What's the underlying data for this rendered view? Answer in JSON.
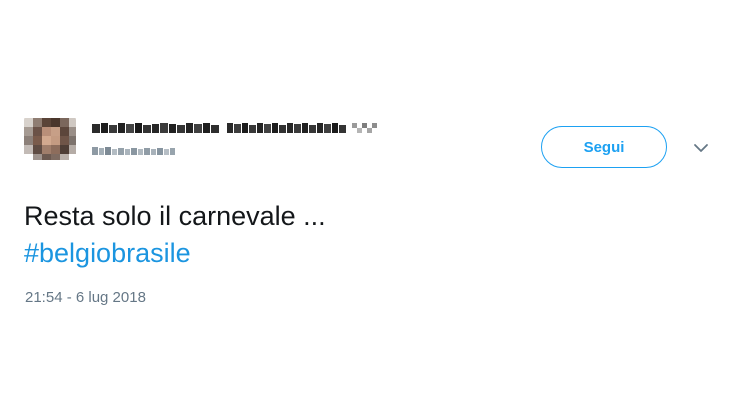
{
  "tweet": {
    "follow_label": "Segui",
    "text": "Resta solo il carnevale ...",
    "hashtag": "#belgiobrasile",
    "timestamp": "21:54 - 6 lug 2018"
  },
  "colors": {
    "accent": "#1da1f2",
    "hashtag": "#1b95e0",
    "text": "#14171a",
    "muted": "#657786"
  },
  "icons": {
    "menu": "chevron-down-icon"
  }
}
